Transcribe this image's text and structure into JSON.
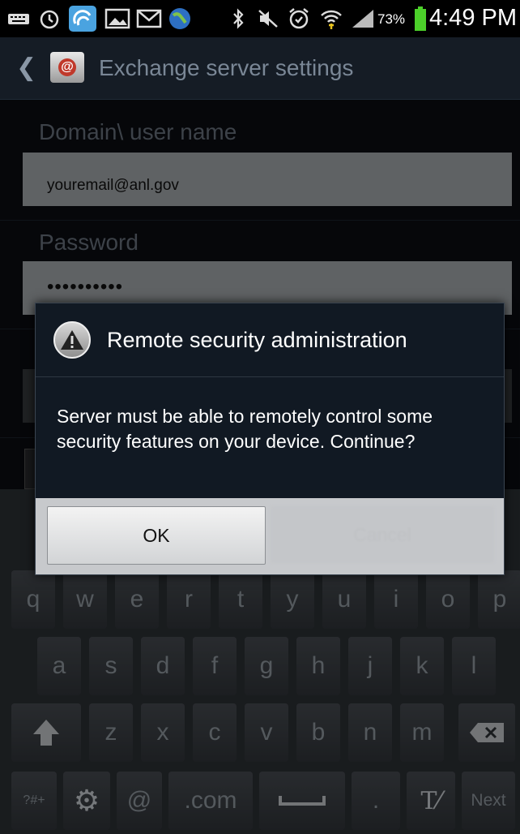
{
  "status_bar": {
    "battery_percent": "73%",
    "time": "4:49 PM",
    "icons": [
      "keyboard-icon",
      "alarm-clock-icon",
      "wifi-app-icon",
      "gallery-icon",
      "gmail-icon",
      "globe-icon",
      "bluetooth-icon",
      "mute-icon",
      "alarm-icon",
      "wifi-signal-icon",
      "cell-signal-icon",
      "battery-icon"
    ]
  },
  "title_bar": {
    "title": "Exchange server settings",
    "app_icon": "email-app-icon"
  },
  "form": {
    "username_label": "Domain\\ user name",
    "username_value": "youremail@anl.gov",
    "password_label": "Password",
    "password_value": "••••••••••"
  },
  "dialog": {
    "title": "Remote security administration",
    "message": "Server  must be able to remotely control some security features on your device. Continue?",
    "ok_label": "OK",
    "cancel_label": "Cancel"
  },
  "keyboard": {
    "row1": [
      "q",
      "w",
      "e",
      "r",
      "t",
      "y",
      "u",
      "i",
      "o",
      "p"
    ],
    "row2": [
      "a",
      "s",
      "d",
      "f",
      "g",
      "h",
      "j",
      "k",
      "l"
    ],
    "row3": [
      "z",
      "x",
      "c",
      "v",
      "b",
      "n",
      "m"
    ],
    "sym_label": "?#+",
    "at_label": "@",
    "com_label": ".com",
    "period_label": ".",
    "next_label": "Next"
  },
  "colors": {
    "accent": "#151c25",
    "dialog_bg": "#111923",
    "button_bar": "#c7c9cc"
  }
}
